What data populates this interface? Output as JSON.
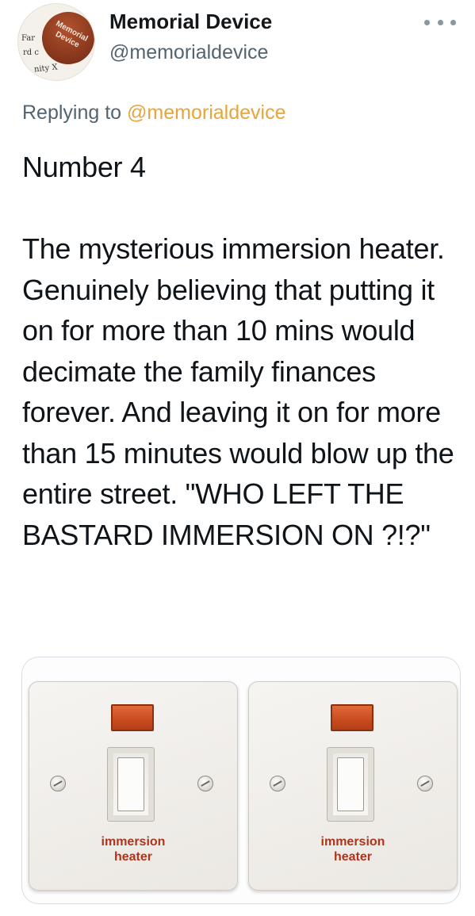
{
  "author": {
    "display_name": "Memorial Device",
    "handle": "@memorialdevice",
    "avatar": {
      "seal_text_line1": "Memorial",
      "seal_text_line2": "Device",
      "stamp_text_1": "Far",
      "stamp_text_2": "rd c",
      "stamp_text_3": "nity X"
    }
  },
  "reply": {
    "prefix": "Replying to ",
    "handle": "@memorialdevice"
  },
  "tweet": {
    "text": "Number 4\n\nThe mysterious immersion heater. Genuinely believing that putting it on for more than 10 mins would decimate the family finances forever. And leaving it on for more than 15 minutes would blow up the entire street. \"WHO LEFT THE BASTARD IMMERSION ON ?!?\""
  },
  "media": {
    "images": [
      {
        "label_line1": "immersion",
        "label_line2": "heater"
      },
      {
        "label_line1": "immersion",
        "label_line2": "heater"
      }
    ]
  },
  "colors": {
    "accent": "#e8a43a",
    "muted": "#536471",
    "text": "#0f1419"
  },
  "icons": {
    "more": "more-horizontal-icon"
  }
}
